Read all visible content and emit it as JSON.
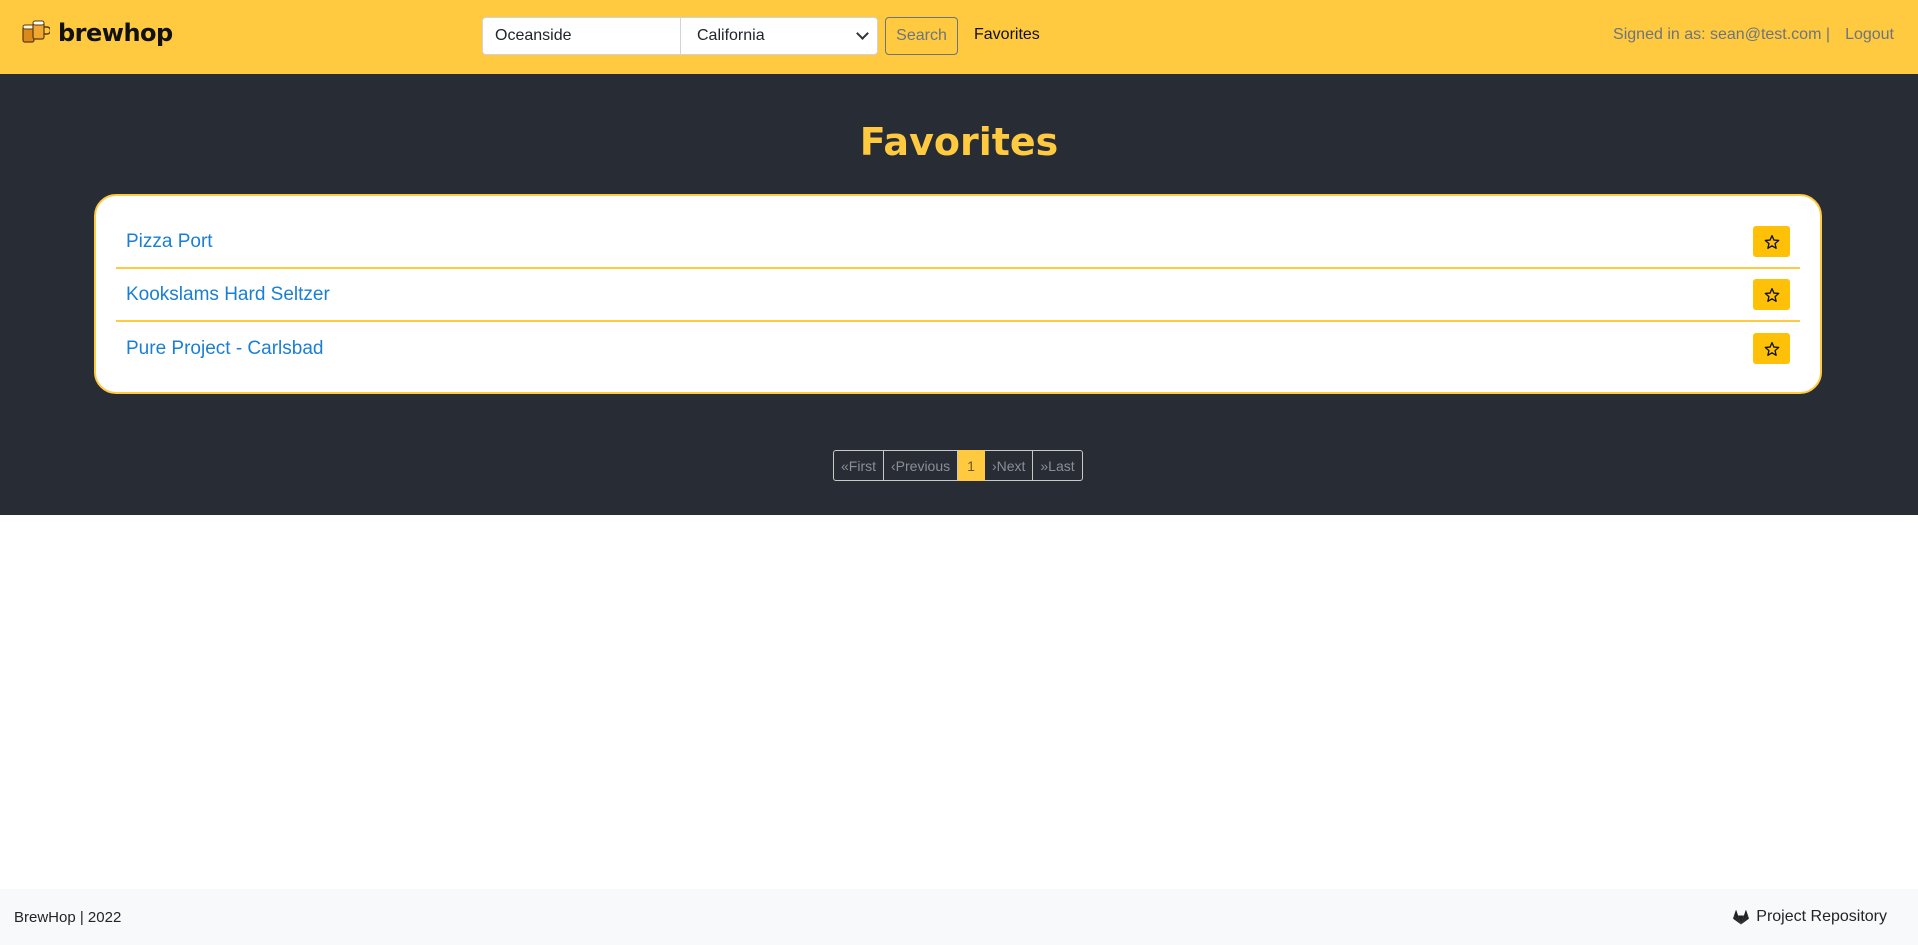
{
  "brand": {
    "name": "brewhop"
  },
  "search": {
    "city_value": "Oceanside",
    "state_value": "California",
    "button_label": "Search"
  },
  "nav": {
    "favorites_label": "Favorites",
    "signed_in_text": "Signed in as: sean@test.com |",
    "logout_label": "Logout"
  },
  "main": {
    "title": "Favorites",
    "favorites": [
      {
        "name": "Pizza Port",
        "icon": "star-icon"
      },
      {
        "name": "Kookslams Hard Seltzer",
        "icon": "star-icon"
      },
      {
        "name": "Pure Project - Carlsbad",
        "icon": "star-icon"
      }
    ]
  },
  "pagination": {
    "first": "«First",
    "previous": "‹Previous",
    "current": "1",
    "next": "›Next",
    "last": "»Last"
  },
  "footer": {
    "left_text": "BrewHop | 2022",
    "repo_label": "Project Repository",
    "repo_icon": "gitlab-icon"
  },
  "colors": {
    "accent": "#ffc940",
    "dark_bg": "#282c34",
    "link": "#1a7fd4",
    "star_button": "#ffc107"
  }
}
